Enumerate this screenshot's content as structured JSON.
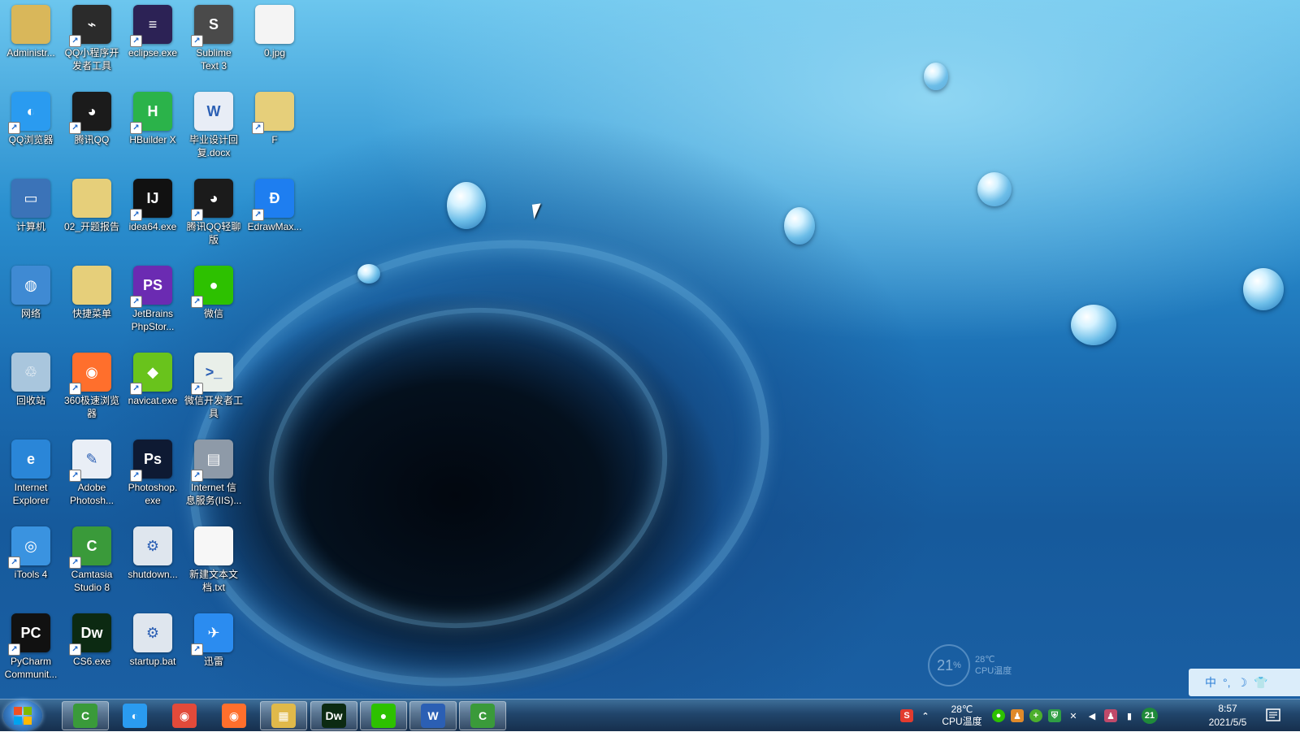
{
  "desktop_icons": [
    {
      "label": "Administr...",
      "glyph": "",
      "bg": "#d9b75a",
      "icon": "user-folder-icon",
      "shortcut": false
    },
    {
      "label": "QQ小程序开\n发者工具",
      "glyph": "⌁",
      "bg": "#2b2b2b",
      "icon": "qq-miniprogram-devtool-icon",
      "shortcut": true
    },
    {
      "label": "eclipse.exe",
      "glyph": "≡",
      "bg": "#2c2255",
      "icon": "eclipse-icon",
      "shortcut": true
    },
    {
      "label": "Sublime\nText 3",
      "glyph": "S",
      "bg": "#4a4a4a",
      "icon": "sublime-text-icon",
      "shortcut": true
    },
    {
      "label": "0.jpg",
      "glyph": "",
      "bg": "#f4f4f4",
      "icon": "image-file-icon",
      "shortcut": false
    },
    {
      "label": "QQ浏览器",
      "glyph": "◐",
      "bg": "#2a9bf0",
      "icon": "qq-browser-icon",
      "shortcut": true
    },
    {
      "label": "腾讯QQ",
      "glyph": "◕",
      "bg": "#1b1b1b",
      "icon": "qq-penguin-icon",
      "shortcut": true
    },
    {
      "label": "HBuilder X",
      "glyph": "H",
      "bg": "#2bb34a",
      "icon": "hbuilder-icon",
      "shortcut": true
    },
    {
      "label": "毕业设计回\n复.docx",
      "glyph": "W",
      "bg": "#e8edf6",
      "icon": "word-document-icon",
      "shortcut": false
    },
    {
      "label": "F",
      "glyph": "",
      "bg": "#e6cf7a",
      "icon": "folder-icon",
      "shortcut": true
    },
    {
      "label": "计算机",
      "glyph": "▭",
      "bg": "#3b73b8",
      "icon": "computer-icon",
      "shortcut": false
    },
    {
      "label": "02_开题报告",
      "glyph": "",
      "bg": "#e6cf7a",
      "icon": "folder-icon",
      "shortcut": false
    },
    {
      "label": "idea64.exe",
      "glyph": "IJ",
      "bg": "#111111",
      "icon": "intellij-idea-icon",
      "shortcut": true
    },
    {
      "label": "腾讯QQ轻聊\n版",
      "glyph": "◕",
      "bg": "#1b1b1b",
      "icon": "qq-lite-icon",
      "shortcut": true
    },
    {
      "label": "EdrawMax...",
      "glyph": "Ð",
      "bg": "#1e7ef0",
      "icon": "edrawmax-icon",
      "shortcut": true
    },
    {
      "label": "网络",
      "glyph": "◍",
      "bg": "#3f8ad3",
      "icon": "network-icon",
      "shortcut": false
    },
    {
      "label": "快捷菜单",
      "glyph": "",
      "bg": "#e6cf7a",
      "icon": "folder-icon",
      "shortcut": false
    },
    {
      "label": "JetBrains\nPhpStor...",
      "glyph": "PS",
      "bg": "#6b2bb2",
      "icon": "phpstorm-icon",
      "shortcut": true
    },
    {
      "label": "微信",
      "glyph": "●",
      "bg": "#2dc100",
      "icon": "wechat-icon",
      "shortcut": true
    },
    {
      "label": "回收站",
      "glyph": "♲",
      "bg": "#a9c6dd",
      "icon": "recycle-bin-icon",
      "shortcut": false
    },
    {
      "label": "360极速浏览\n器",
      "glyph": "◉",
      "bg": "#ff6f2c",
      "icon": "browser-360-icon",
      "shortcut": true
    },
    {
      "label": "navicat.exe",
      "glyph": "◆",
      "bg": "#69c31c",
      "icon": "navicat-icon",
      "shortcut": true
    },
    {
      "label": "微信开发者工\n具",
      "glyph": ">_",
      "bg": "#e9efe9",
      "icon": "wechat-devtool-icon",
      "shortcut": true
    },
    {
      "label": "Internet\nExplorer",
      "glyph": "e",
      "bg": "#2a86d8",
      "icon": "internet-explorer-icon",
      "shortcut": false
    },
    {
      "label": "Adobe\nPhotosh...",
      "glyph": "✎",
      "bg": "#e9eef6",
      "icon": "adobe-photoshop-installer-icon",
      "shortcut": true
    },
    {
      "label": "Photoshop.\nexe",
      "glyph": "Ps",
      "bg": "#0e1a33",
      "icon": "photoshop-icon",
      "shortcut": true
    },
    {
      "label": "Internet 信\n息服务(IIS)...",
      "glyph": "▤",
      "bg": "#8e9aa8",
      "icon": "iis-manager-icon",
      "shortcut": true
    },
    {
      "label": "iTools 4",
      "glyph": "◎",
      "bg": "#3a93e0",
      "icon": "itools-icon",
      "shortcut": true
    },
    {
      "label": "Camtasia\nStudio 8",
      "glyph": "C",
      "bg": "#3a9a3a",
      "icon": "camtasia-icon",
      "shortcut": true
    },
    {
      "label": "shutdown...",
      "glyph": "⚙",
      "bg": "#dfe6ee",
      "icon": "batch-file-icon",
      "shortcut": false
    },
    {
      "label": "新建文本文\n档.txt",
      "glyph": "",
      "bg": "#f7f7f7",
      "icon": "text-file-icon",
      "shortcut": false
    },
    {
      "label": "PyCharm\nCommunit...",
      "glyph": "PC",
      "bg": "#111111",
      "icon": "pycharm-icon",
      "shortcut": true
    },
    {
      "label": "CS6.exe",
      "glyph": "Dw",
      "bg": "#0c2a12",
      "icon": "dreamweaver-icon",
      "shortcut": true
    },
    {
      "label": "startup.bat",
      "glyph": "⚙",
      "bg": "#dfe6ee",
      "icon": "batch-file-icon",
      "shortcut": false
    },
    {
      "label": "迅雷",
      "glyph": "✈",
      "bg": "#2b8cf0",
      "icon": "thunder-icon",
      "shortcut": true
    }
  ],
  "widgets": {
    "cpu_usage": "21",
    "cpu_usage_unit": "%",
    "cpu_side_temp": "28℃",
    "cpu_side_label": "CPU温度"
  },
  "ime_bar": {
    "mode": "中",
    "items": [
      "°,",
      "☽",
      "👕"
    ]
  },
  "taskbar": {
    "pinned": [
      {
        "name": "camtasia",
        "glyph": "C",
        "bg": "#3a9a3a",
        "icon": "camtasia-icon",
        "active": true
      },
      {
        "name": "qq-browser",
        "glyph": "◐",
        "bg": "#2a9bf0",
        "icon": "qq-browser-icon",
        "active": false
      },
      {
        "name": "chrome",
        "glyph": "◉",
        "bg": "#e24a3a",
        "icon": "chrome-icon",
        "active": false
      },
      {
        "name": "360-browser",
        "glyph": "◉",
        "bg": "#ff6f2c",
        "icon": "browser-360-icon",
        "active": false
      },
      {
        "name": "explorer",
        "glyph": "▦",
        "bg": "#e0b94a",
        "icon": "file-explorer-icon",
        "active": true
      },
      {
        "name": "dreamweaver",
        "glyph": "Dw",
        "bg": "#0c2a12",
        "icon": "dreamweaver-icon",
        "active": true
      },
      {
        "name": "wechat",
        "glyph": "●",
        "bg": "#2dc100",
        "icon": "wechat-icon",
        "active": true
      },
      {
        "name": "word",
        "glyph": "W",
        "bg": "#2b5fb4",
        "icon": "word-icon",
        "active": true
      },
      {
        "name": "camtasia-recorder",
        "glyph": "C",
        "bg": "#3a9a3a",
        "icon": "camtasia-recorder-icon",
        "active": true
      }
    ],
    "tray": {
      "temp": "28℃",
      "temp_label": "CPU温度",
      "badge": "21",
      "time": "8:57",
      "date": "2021/5/5"
    }
  }
}
